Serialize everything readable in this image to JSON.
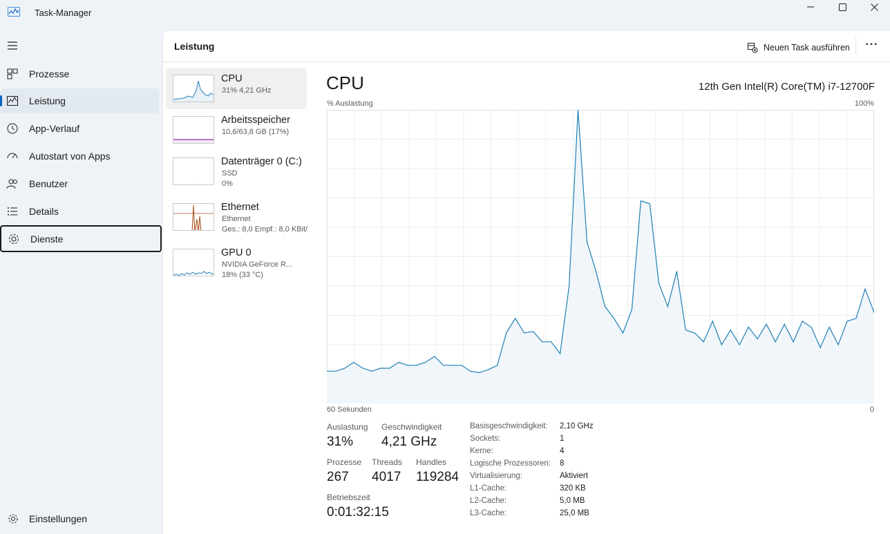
{
  "window": {
    "title": "Task-Manager"
  },
  "nav": {
    "items": [
      {
        "label": "Prozesse"
      },
      {
        "label": "Leistung"
      },
      {
        "label": "App-Verlauf"
      },
      {
        "label": "Autostart von Apps"
      },
      {
        "label": "Benutzer"
      },
      {
        "label": "Details"
      },
      {
        "label": "Dienste"
      }
    ],
    "settings": "Einstellungen"
  },
  "header": {
    "title": "Leistung",
    "run_task": "Neuen Task ausführen",
    "more": "···"
  },
  "devices": [
    {
      "name": "CPU",
      "sub1": "31% 4,21 GHz"
    },
    {
      "name": "Arbeitsspeicher",
      "sub1": "10,6/63,8 GB (17%)"
    },
    {
      "name": "Datenträger 0 (C:)",
      "sub1": "SSD",
      "sub2": "0%"
    },
    {
      "name": "Ethernet",
      "sub1": "Ethernet",
      "sub2": "Ges.: 8,0 Empf.: 8,0 KBit/"
    },
    {
      "name": "GPU 0",
      "sub1": "NVIDIA GeForce R...",
      "sub2": "18%  (33 °C)"
    }
  ],
  "detail": {
    "title": "CPU",
    "model": "12th Gen Intel(R) Core(TM) i7-12700F",
    "y_label": "% Auslastung",
    "y_max": "100%",
    "x_left": "60 Sekunden",
    "x_right": "0"
  },
  "stats": {
    "auslastung_label": "Auslastung",
    "auslastung": "31%",
    "geschw_label": "Geschwindigkeit",
    "geschw": "4,21 GHz",
    "prozesse_label": "Prozesse",
    "prozesse": "267",
    "threads_label": "Threads",
    "threads": "4017",
    "handles_label": "Handles",
    "handles": "119284",
    "betrieb_label": "Betriebszeit",
    "betrieb": "0:01:32:15"
  },
  "specs": [
    {
      "k": "Basisgeschwindigkeit:",
      "v": "2,10 GHz"
    },
    {
      "k": "Sockets:",
      "v": "1"
    },
    {
      "k": "Kerne:",
      "v": "4"
    },
    {
      "k": "Logische Prozessoren:",
      "v": "8"
    },
    {
      "k": "Virtualisierung:",
      "v": "Aktiviert"
    },
    {
      "k": "L1-Cache:",
      "v": "320 KB"
    },
    {
      "k": "L2-Cache:",
      "v": "5,0 MB"
    },
    {
      "k": "L3-Cache:",
      "v": "25,0 MB"
    }
  ],
  "colors": {
    "cpu_line": "#1f7fb4",
    "cpu_fill": "#f1f6fa",
    "mem": "#8b2fa0",
    "eth": "#a8501e",
    "grid": "#e6eef4"
  },
  "chart_data": {
    "type": "area",
    "x_range_seconds": [
      60,
      0
    ],
    "ylim": [
      0,
      100
    ],
    "values": [
      11,
      11,
      12,
      14,
      12,
      11,
      12,
      12,
      14,
      13,
      13,
      14,
      16,
      13,
      13,
      13,
      11,
      10.5,
      11.5,
      13,
      24,
      29,
      24,
      24.5,
      21,
      21,
      17,
      40,
      100,
      55,
      45,
      33,
      29,
      24,
      32,
      69,
      68,
      41,
      33,
      45,
      25,
      24,
      21,
      28,
      20,
      25,
      20,
      26,
      22,
      27,
      21,
      27,
      21,
      28,
      26,
      19,
      26,
      20,
      28,
      29,
      39,
      31
    ]
  }
}
